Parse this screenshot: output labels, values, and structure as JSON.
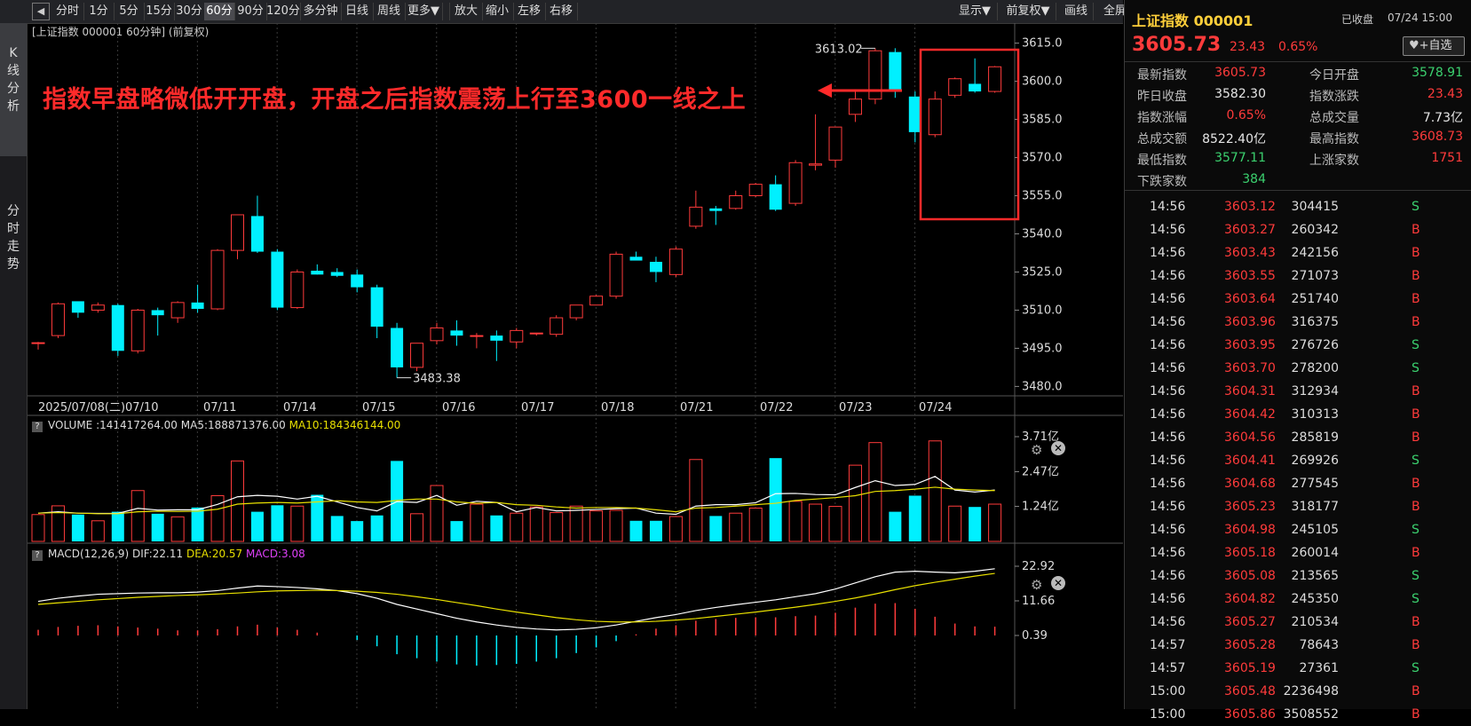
{
  "toolbar": {
    "back_icon": "back-icon",
    "periods": [
      "分时",
      "1分",
      "5分",
      "15分",
      "30分",
      "60分",
      "90分",
      "120分",
      "多分钟",
      "日线",
      "周线",
      "更多▼",
      "放大",
      "缩小",
      "左移",
      "右移"
    ],
    "active_period": "60分",
    "right_buttons": [
      "显示▼",
      "前复权▼",
      "画线",
      "全屏"
    ]
  },
  "left_tabs": [
    "K\n线\n分\n析",
    "分\n时\n走\n势"
  ],
  "chart_header": "[上证指数 000001 60分钟]  (前复权)",
  "annotation": "指数早盘略微低开开盘，开盘之后指数震荡上行至3600一线之上",
  "colors": {
    "up": "#ff3b3b",
    "down": "#00f0ff",
    "ma5": "#ffffff",
    "ma10": "#e8e000",
    "bg": "#000000"
  },
  "chart_data": [
    {
      "type": "candlestick",
      "y_ticks": [
        "3615.0",
        "3600.0",
        "3585.0",
        "3570.0",
        "3555.0",
        "3540.0",
        "3525.0",
        "3510.0",
        "3495.0",
        "3480.0"
      ],
      "ylim": [
        3477,
        3618
      ],
      "x_labels": [
        "2025/07/08(二)",
        "07/10",
        "07/11",
        "07/14",
        "07/15",
        "07/16",
        "07/17",
        "07/18",
        "07/21",
        "07/22",
        "07/23",
        "07/24"
      ],
      "max_label": "3613.02",
      "min_label": "3483.38",
      "ohlc": [
        [
          3497.0,
          3497.5,
          3494.5,
          3497.2
        ],
        [
          3500.0,
          3513.0,
          3499.0,
          3512.5
        ],
        [
          3513.5,
          3512.5,
          3507.0,
          3509.0
        ],
        [
          3510.0,
          3513.0,
          3509.0,
          3512.0
        ],
        [
          3512.0,
          3512.5,
          3492.0,
          3494.0
        ],
        [
          3494.0,
          3510.5,
          3493.0,
          3510.0
        ],
        [
          3510.0,
          3511.0,
          3500.0,
          3508.0
        ],
        [
          3507.0,
          3513.5,
          3505.0,
          3513.0
        ],
        [
          3513.0,
          3520.0,
          3509.0,
          3510.5
        ],
        [
          3510.5,
          3534.0,
          3510.0,
          3533.5
        ],
        [
          3533.5,
          3547.5,
          3530.0,
          3547.5
        ],
        [
          3547.0,
          3555.0,
          3532.5,
          3533.0
        ],
        [
          3533.0,
          3534.0,
          3510.0,
          3511.0
        ],
        [
          3511.0,
          3526.0,
          3510.5,
          3525.0
        ],
        [
          3525.5,
          3528.0,
          3524.0,
          3524.0
        ],
        [
          3525.0,
          3526.5,
          3523.0,
          3523.5
        ],
        [
          3524.0,
          3526.0,
          3517.0,
          3519.0
        ],
        [
          3519.0,
          3520.0,
          3499.0,
          3503.5
        ],
        [
          3503.0,
          3505.0,
          3483.4,
          3487.5
        ],
        [
          3487.5,
          3497.0,
          3486.0,
          3497.0
        ],
        [
          3498.0,
          3505.0,
          3496.5,
          3503.0
        ],
        [
          3502.0,
          3506.0,
          3496.0,
          3500.0
        ],
        [
          3500.0,
          3501.0,
          3495.0,
          3500.0
        ],
        [
          3500.0,
          3502.0,
          3490.0,
          3498.0
        ],
        [
          3497.5,
          3503.0,
          3495.0,
          3502.0
        ],
        [
          3501.0,
          3501.0,
          3500.0,
          3501.0
        ],
        [
          3500.5,
          3508.0,
          3499.5,
          3507.0
        ],
        [
          3507.0,
          3512.0,
          3506.0,
          3512.0
        ],
        [
          3512.0,
          3516.0,
          3512.0,
          3515.5
        ],
        [
          3515.5,
          3533.0,
          3514.5,
          3532.0
        ],
        [
          3531.0,
          3533.0,
          3530.0,
          3529.5
        ],
        [
          3529.0,
          3531.0,
          3521.0,
          3525.0
        ],
        [
          3524.0,
          3535.0,
          3523.0,
          3534.0
        ],
        [
          3543.0,
          3557.0,
          3542.0,
          3550.5
        ],
        [
          3550.0,
          3551.0,
          3543.5,
          3549.0
        ],
        [
          3550.0,
          3557.0,
          3549.5,
          3555.0
        ],
        [
          3555.0,
          3560.0,
          3554.5,
          3559.5
        ],
        [
          3559.5,
          3563.0,
          3549.0,
          3549.5
        ],
        [
          3552.0,
          3569.0,
          3551.0,
          3568.0
        ],
        [
          3567.0,
          3587.0,
          3565.0,
          3567.5
        ],
        [
          3569.0,
          3582.0,
          3566.0,
          3582.0
        ],
        [
          3587.0,
          3596.0,
          3584.0,
          3593.0
        ],
        [
          3593.0,
          3613.0,
          3591.0,
          3612.0
        ],
        [
          3611.5,
          3613.0,
          3593.5,
          3596.0
        ],
        [
          3594.0,
          3596.0,
          3576.0,
          3580.0
        ],
        [
          3579.0,
          3596.0,
          3578.0,
          3593.0
        ],
        [
          3594.5,
          3601.5,
          3593.5,
          3601.0
        ],
        [
          3599.0,
          3609.0,
          3595.5,
          3596.0
        ],
        [
          3596.0,
          3606.0,
          3595.5,
          3605.7
        ]
      ],
      "volume_ticks": [
        "3.71亿",
        "2.47亿",
        "1.24亿"
      ],
      "volume_legend": {
        "name": "VOLUME",
        "volume": ":141417264.00",
        "ma5": "MA5:188871376.00",
        "ma10": "MA10:184346144.00"
      },
      "volume_yi": [
        0.95,
        1.26,
        0.95,
        0.73,
        1.05,
        1.8,
        0.98,
        0.87,
        1.2,
        1.62,
        2.85,
        1.05,
        1.28,
        1.25,
        1.65,
        0.9,
        0.72,
        0.92,
        2.85,
        0.98,
        1.98,
        0.72,
        1.32,
        0.92,
        1.0,
        1.22,
        1.02,
        1.25,
        1.08,
        1.1,
        0.73,
        0.73,
        0.88,
        2.9,
        0.9,
        1.0,
        1.18,
        2.95,
        1.42,
        1.32,
        1.24,
        2.7,
        3.5,
        1.05,
        1.62,
        3.56,
        1.25,
        1.22,
        1.32
      ],
      "volume_ma5_yi": [
        1.0,
        1.05,
        1.0,
        0.99,
        0.99,
        1.17,
        1.11,
        1.12,
        1.12,
        1.31,
        1.58,
        1.63,
        1.6,
        1.5,
        1.6,
        1.4,
        1.2,
        1.08,
        1.41,
        1.38,
        1.63,
        1.28,
        1.42,
        1.38,
        1.05,
        1.2,
        1.08,
        1.1,
        1.13,
        1.16,
        1.18,
        1.0,
        0.96,
        1.25,
        1.3,
        1.3,
        1.37,
        1.69,
        1.7,
        1.66,
        1.65,
        1.91,
        2.15,
        1.98,
        2.02,
        2.3,
        1.82,
        1.75,
        1.82
      ],
      "volume_ma10_yi": [
        1.0,
        1.02,
        1.0,
        0.98,
        0.98,
        1.05,
        1.07,
        1.06,
        1.07,
        1.14,
        1.32,
        1.36,
        1.38,
        1.36,
        1.4,
        1.44,
        1.4,
        1.38,
        1.45,
        1.5,
        1.5,
        1.4,
        1.35,
        1.38,
        1.3,
        1.28,
        1.22,
        1.18,
        1.2,
        1.2,
        1.18,
        1.12,
        1.05,
        1.18,
        1.2,
        1.25,
        1.3,
        1.35,
        1.45,
        1.5,
        1.55,
        1.62,
        1.77,
        1.8,
        1.85,
        1.92,
        1.85,
        1.82,
        1.8
      ],
      "macd_ticks": [
        "22.92",
        "11.66",
        "0.39"
      ],
      "macd_legend": {
        "name": "MACD(12,26,9)",
        "dif": "DIF:22.11",
        "dea": "DEA:20.57",
        "macd": "MACD:3.08"
      },
      "macd_dif": [
        11.5,
        12.5,
        13.2,
        13.8,
        14.0,
        14.2,
        14.3,
        14.3,
        14.5,
        15.0,
        15.8,
        16.5,
        16.3,
        16.0,
        15.6,
        15.0,
        14.0,
        12.5,
        10.5,
        9.0,
        7.5,
        6.0,
        4.8,
        3.8,
        3.0,
        2.5,
        2.2,
        2.4,
        2.9,
        3.8,
        5.0,
        6.2,
        7.2,
        8.5,
        9.5,
        10.4,
        11.2,
        12.0,
        13.0,
        14.0,
        15.5,
        17.5,
        19.5,
        21.0,
        21.3,
        21.0,
        20.8,
        21.3,
        22.1
      ],
      "macd_dea": [
        10.5,
        11.0,
        11.5,
        12.0,
        12.4,
        12.8,
        13.1,
        13.4,
        13.6,
        13.9,
        14.2,
        14.6,
        14.9,
        15.0,
        15.1,
        15.0,
        14.8,
        14.4,
        13.8,
        13.0,
        12.1,
        11.1,
        10.1,
        9.0,
        8.0,
        7.1,
        6.2,
        5.5,
        5.0,
        4.8,
        4.8,
        5.0,
        5.4,
        5.9,
        6.6,
        7.3,
        8.0,
        8.8,
        9.6,
        10.5,
        11.5,
        12.6,
        13.9,
        15.3,
        16.6,
        17.7,
        18.7,
        19.7,
        20.6
      ],
      "macd_hist": [
        2.0,
        3.0,
        3.4,
        3.6,
        3.2,
        2.8,
        2.4,
        1.8,
        1.8,
        2.2,
        3.2,
        3.8,
        2.8,
        2.0,
        1.0,
        0.0,
        -1.6,
        -3.8,
        -6.6,
        -8.0,
        -9.2,
        -10.2,
        -10.6,
        -10.4,
        -10.0,
        -9.2,
        -8.0,
        -6.2,
        -4.2,
        -2.0,
        0.4,
        2.4,
        3.6,
        5.2,
        5.8,
        6.2,
        6.4,
        6.4,
        6.8,
        7.0,
        8.0,
        9.8,
        11.2,
        11.4,
        9.4,
        6.6,
        4.2,
        3.2,
        3.1
      ]
    }
  ],
  "quote": {
    "title": "上证指数 000001",
    "status": "已收盘",
    "datetime": "07/24 15:00",
    "price": "3605.73",
    "change": "23.43",
    "change_pct": "0.65%",
    "watch_btn": "+自选",
    "heart_icon": "heart-icon",
    "fields": [
      [
        "最新指数",
        "3605.73",
        "red",
        "今日开盘",
        "3578.91",
        "green"
      ],
      [
        "昨日收盘",
        "3582.30",
        "white",
        "指数涨跌",
        "23.43",
        "red"
      ],
      [
        "指数涨幅",
        "0.65%",
        "red",
        "总成交量",
        "7.73亿",
        "white"
      ],
      [
        "总成交额",
        "8522.40亿",
        "white",
        "最高指数",
        "3608.73",
        "red"
      ],
      [
        "最低指数",
        "3577.11",
        "green",
        "上涨家数",
        "1751",
        "red"
      ],
      [
        "下跌家数",
        "384",
        "green",
        "",
        "",
        " "
      ]
    ]
  },
  "ticks": [
    [
      "14:56",
      "3603.12",
      "304415",
      "S"
    ],
    [
      "14:56",
      "3603.27",
      "260342",
      "B"
    ],
    [
      "14:56",
      "3603.43",
      "242156",
      "B"
    ],
    [
      "14:56",
      "3603.55",
      "271073",
      "B"
    ],
    [
      "14:56",
      "3603.64",
      "251740",
      "B"
    ],
    [
      "14:56",
      "3603.96",
      "316375",
      "B"
    ],
    [
      "14:56",
      "3603.95",
      "276726",
      "S"
    ],
    [
      "14:56",
      "3603.70",
      "278200",
      "S"
    ],
    [
      "14:56",
      "3604.31",
      "312934",
      "B"
    ],
    [
      "14:56",
      "3604.42",
      "310313",
      "B"
    ],
    [
      "14:56",
      "3604.56",
      "285819",
      "B"
    ],
    [
      "14:56",
      "3604.41",
      "269926",
      "S"
    ],
    [
      "14:56",
      "3604.68",
      "277545",
      "B"
    ],
    [
      "14:56",
      "3605.23",
      "318177",
      "B"
    ],
    [
      "14:56",
      "3604.98",
      "245105",
      "S"
    ],
    [
      "14:56",
      "3605.18",
      "260014",
      "B"
    ],
    [
      "14:56",
      "3605.08",
      "213565",
      "S"
    ],
    [
      "14:56",
      "3604.82",
      "245350",
      "S"
    ],
    [
      "14:56",
      "3605.27",
      "210534",
      "B"
    ],
    [
      "14:57",
      "3605.28",
      "78643",
      "B"
    ],
    [
      "14:57",
      "3605.19",
      "27361",
      "S"
    ],
    [
      "15:00",
      "3605.48",
      "2236498",
      "B"
    ],
    [
      "15:00",
      "3605.86",
      "3508552",
      "B"
    ]
  ]
}
